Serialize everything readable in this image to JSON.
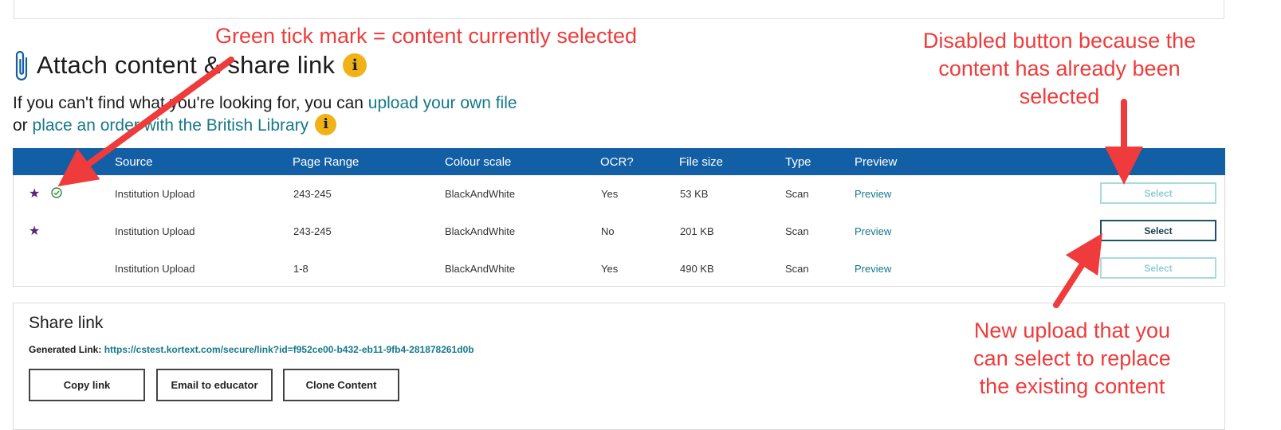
{
  "heading": {
    "title": "Attach content & share link",
    "info_glyph": "i"
  },
  "intro": {
    "line1_prefix": "If you can't find what you're looking for, you can ",
    "upload_link": "upload your own file",
    "line2_prefix": "or ",
    "order_link": "place an order with the British Library",
    "info_glyph": "i"
  },
  "table": {
    "headers": [
      "Source",
      "Page Range",
      "Colour scale",
      "OCR?",
      "File size",
      "Type",
      "Preview"
    ],
    "rows": [
      {
        "starred": true,
        "selected": true,
        "source": "Institution Upload",
        "page_range": "243-245",
        "colour": "BlackAndWhite",
        "ocr": "Yes",
        "size": "53 KB",
        "type": "Scan",
        "preview": "Preview",
        "select": "Select",
        "select_state": "disabled"
      },
      {
        "starred": true,
        "selected": false,
        "source": "Institution Upload",
        "page_range": "243-245",
        "colour": "BlackAndWhite",
        "ocr": "No",
        "size": "201 KB",
        "type": "Scan",
        "preview": "Preview",
        "select": "Select",
        "select_state": "active"
      },
      {
        "starred": false,
        "selected": false,
        "source": "Institution Upload",
        "page_range": "1-8",
        "colour": "BlackAndWhite",
        "ocr": "Yes",
        "size": "490 KB",
        "type": "Scan",
        "preview": "Preview",
        "select": "Select",
        "select_state": "disabled"
      }
    ],
    "star_glyph": "★"
  },
  "share": {
    "title": "Share link",
    "generated_label": "Generated Link: ",
    "url": "https://cstest.kortext.com/secure/link?id=f952ce00-b432-eb11-9fb4-281878261d0b",
    "buttons": [
      "Copy link",
      "Email to educator",
      "Clone Content"
    ]
  },
  "annotations": {
    "tick": "Green tick mark = content currently selected",
    "disabled_line1": "Disabled button because the",
    "disabled_line2": "content has already been",
    "disabled_line3": "selected",
    "new_line1": "New upload that you",
    "new_line2": "can select to replace",
    "new_line3": "the existing content"
  },
  "colors": {
    "header_blue": "#135fa6",
    "link_teal": "#15788a",
    "info_yellow": "#f1b218",
    "star_purple": "#5a2379",
    "tick_green": "#2e8b3d",
    "annotation_red": "#ef3b3b"
  },
  "icons": [
    "paperclip-icon",
    "info-icon",
    "star-icon",
    "check-circle-icon"
  ]
}
